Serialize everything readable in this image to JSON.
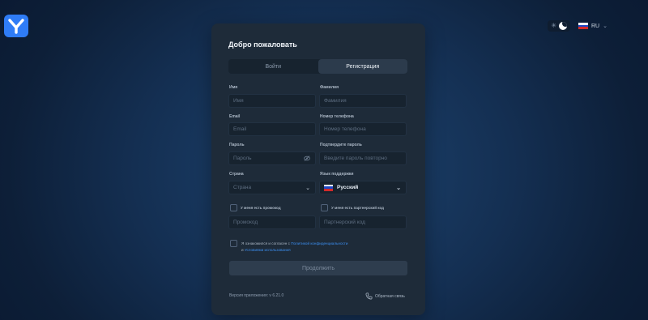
{
  "header": {
    "theme": {
      "sun_icon": "sun-icon",
      "moon_icon": "moon-icon"
    },
    "language": {
      "code": "RU"
    }
  },
  "form": {
    "title": "Добро пожаловать",
    "tabs": [
      {
        "label": "Войти"
      },
      {
        "label": "Регистрация"
      }
    ],
    "fields": {
      "first_name": {
        "label": "Имя",
        "placeholder": "Имя"
      },
      "last_name": {
        "label": "Фамилия",
        "placeholder": "Фамилия"
      },
      "email": {
        "label": "Email",
        "placeholder": "Email"
      },
      "phone": {
        "label": "Номер телефона",
        "placeholder": "Номер телефона"
      },
      "password": {
        "label": "Пароль",
        "placeholder": "Пароль"
      },
      "confirm_password": {
        "label": "Подтвердите пароль",
        "placeholder": "Введите пароль повторно"
      },
      "country": {
        "label": "Страна",
        "placeholder": "Страна"
      },
      "support_language": {
        "label": "Язык поддержки",
        "value": "Русский"
      },
      "promo_check": {
        "label": "У меня есть промокод"
      },
      "promo": {
        "placeholder": "Промокод"
      },
      "partner_check": {
        "label": "У меня есть партнерский код"
      },
      "partner": {
        "placeholder": "Партнерский код"
      }
    },
    "agree": {
      "text1": "Я ознакомился и согласен с",
      "link1": "Политикой конфиденциальности",
      "text2": "и",
      "link2": "Условиями использования"
    },
    "submit": "Продолжить",
    "version": "Версия приложения: v 6.21.0",
    "support": "Обратная связь"
  },
  "colors": {
    "accent": "#2f7cf6",
    "link": "#3b8ef0",
    "card": "#1e2b39"
  }
}
